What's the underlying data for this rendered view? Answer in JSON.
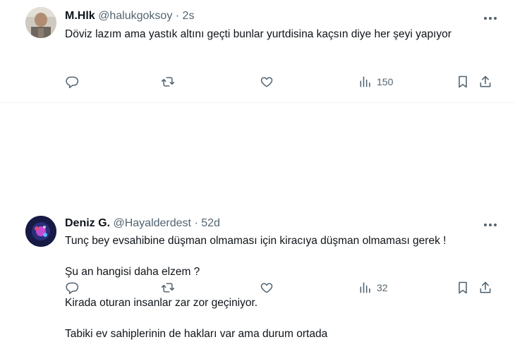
{
  "tweets": [
    {
      "name": "M.Hlk",
      "handle": "@halukgoksoy",
      "separator": "·",
      "time": "2s",
      "text_lines": [
        "Döviz lazım ama yastık altını geçti  bunlar yurtdisina kaçsın diye her şeyi yapıyor"
      ],
      "views": "150"
    },
    {
      "name": "Deniz G.",
      "handle": "@Hayalderdest",
      "separator": "·",
      "time": "52d",
      "paragraphs": [
        "Tunç bey evsahibine düşman olmaması için kiracıya düşman olmaması gerek !",
        "Şu an hangisi daha elzem ?",
        "Kirada oturan insanlar zar zor geçiniyor.",
        "Tabiki ev sahiplerinin de hakları var ama durum ortada"
      ],
      "views": "32"
    }
  ],
  "icons": [
    "reply-icon",
    "retweet-icon",
    "like-icon",
    "views-icon",
    "bookmark-icon",
    "share-icon",
    "more-icon"
  ],
  "colors": {
    "text": "#0f1419",
    "secondary": "#536471",
    "divider": "#eff3f4"
  }
}
